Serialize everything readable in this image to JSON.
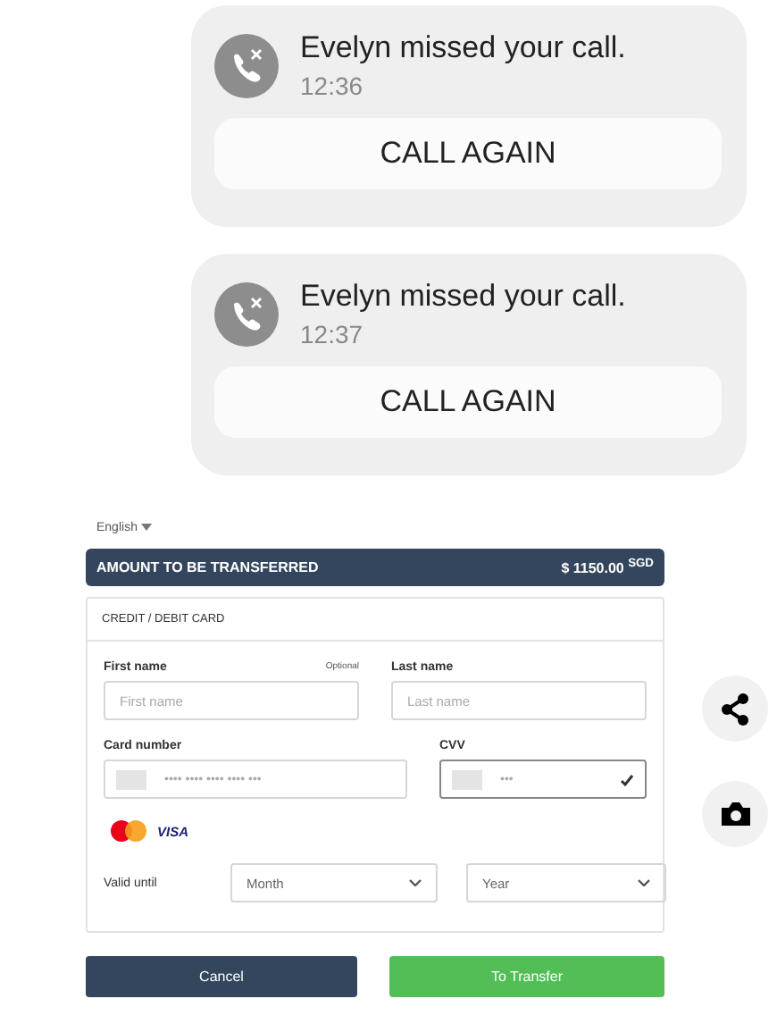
{
  "notifications": [
    {
      "title": "Evelyn missed your call.",
      "time": "12:36",
      "action": "CALL AGAIN"
    },
    {
      "title": "Evelyn missed your call.",
      "time": "12:37",
      "action": "CALL AGAIN"
    }
  ],
  "payment": {
    "language": "English",
    "amount_label": "AMOUNT TO BE TRANSFERRED",
    "amount": "$ 1150.00 $^{SGD}$",
    "section": "CREDIT / DEBIT CARD",
    "first_name": {
      "label": "First name",
      "hint": "Optional",
      "placeholder": "First name"
    },
    "last_name": {
      "label": "Last name",
      "placeholder": "Last name"
    },
    "card_number": {
      "label": "Card number",
      "placeholder": "•••• •••• •••• •••• •••"
    },
    "cvv": {
      "label": "CVV",
      "placeholder": "•••",
      "valid": true
    },
    "card_brand": "VISA",
    "valid_until": {
      "label": "Valid until",
      "month": "Month",
      "year": "Year"
    },
    "buttons": [
      {
        "kind": "cancel",
        "label": "Cancel"
      },
      {
        "kind": "submit",
        "label": "To Transfer"
      }
    ]
  },
  "side_actions": [
    {
      "kind": "share"
    },
    {
      "kind": "camera"
    }
  ]
}
